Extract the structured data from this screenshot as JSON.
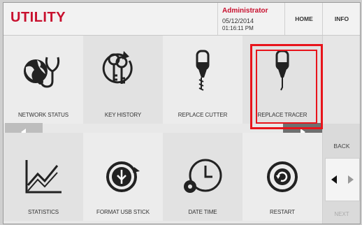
{
  "header": {
    "title": "UTILITY",
    "user": "Administrator",
    "date": "05/12/2014",
    "time": "01:16:11 PM",
    "home_label": "HOME",
    "info_label": "INFO"
  },
  "tiles": [
    {
      "label": "NETWORK STATUS",
      "icon": "network-status-icon"
    },
    {
      "label": "KEY HISTORY",
      "icon": "key-history-icon"
    },
    {
      "label": "REPLACE CUTTER",
      "icon": "cutter-icon"
    },
    {
      "label": "REPLACE TRACER",
      "icon": "tracer-icon"
    },
    {
      "label": "STATISTICS",
      "icon": "statistics-icon"
    },
    {
      "label": "FORMAT USB STICK",
      "icon": "usb-icon"
    },
    {
      "label": "DATE TIME",
      "icon": "clock-icon"
    },
    {
      "label": "RESTART",
      "icon": "restart-icon"
    }
  ],
  "side": {
    "back_label": "BACK",
    "next_label": "NEXT"
  },
  "colors": {
    "brand": "#c8102e",
    "highlight": "#e8141b"
  }
}
